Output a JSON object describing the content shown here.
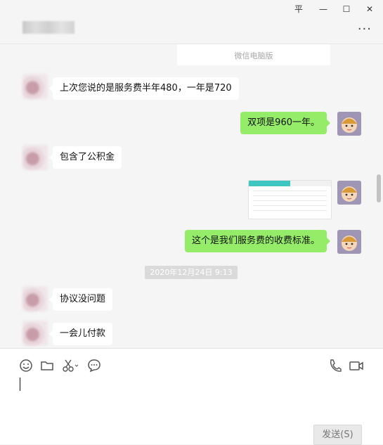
{
  "window": {
    "pin_glyph": "平",
    "minimize_glyph": "—",
    "maximize_glyph": "☐",
    "close_glyph": "✕",
    "more_glyph": "···"
  },
  "chat": {
    "system_note": "微信电脑版",
    "timestamp": "2020年12月24日 9:13",
    "messages": [
      {
        "direction": "in",
        "text": "上次您说的是服务费半年480，一年是720"
      },
      {
        "direction": "out",
        "text": "双项是960一年。"
      },
      {
        "direction": "in",
        "text": "包含了公积金"
      },
      {
        "direction": "out",
        "type": "image",
        "icon": "table-screenshot-icon"
      },
      {
        "direction": "out",
        "text": "这个是我们服务费的收费标准。"
      },
      {
        "direction": "in",
        "text": "协议没问题"
      },
      {
        "direction": "in",
        "text": "一会儿付款"
      }
    ]
  },
  "toolbar": {
    "icons": [
      "emoji-icon",
      "folder-icon",
      "scissors-icon",
      "chat-history-icon",
      "phone-icon",
      "video-icon"
    ],
    "send_label": "发送(S)"
  }
}
